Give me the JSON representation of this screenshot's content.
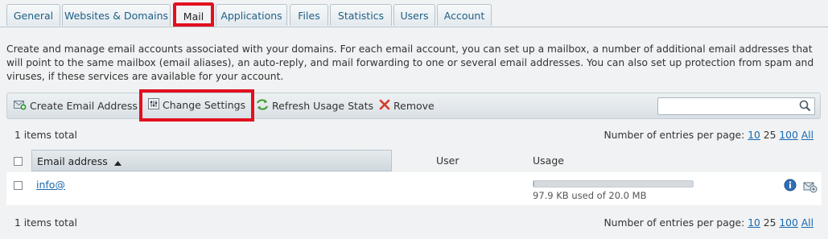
{
  "tabs": [
    "General",
    "Websites & Domains",
    "Mail",
    "Applications",
    "Files",
    "Statistics",
    "Users",
    "Account"
  ],
  "description": "Create and manage email accounts associated with your domains. For each email account, you can set up a mailbox, a number of additional email addresses that will point to the same mailbox (email aliases), an auto-reply, and mail forwarding to one or several email addresses. You can also set up protection from spam and viruses, if these services are available for your account.",
  "toolbar": {
    "create": "Create Email Address",
    "change": "Change Settings",
    "refresh": "Refresh Usage Stats",
    "remove": "Remove",
    "search_value": ""
  },
  "list": {
    "total": "1 items total",
    "per_page_label": "Number of entries per page:",
    "per_page_options": [
      "10",
      "25",
      "100",
      "All"
    ]
  },
  "columns": {
    "email": "Email address",
    "user": "User",
    "usage": "Usage"
  },
  "rows": [
    {
      "email": "info@",
      "user": "",
      "usage_text": "97.9 KB used of 20.0 MB",
      "usage_fraction": 0.005
    }
  ],
  "colors": {
    "highlight": "#e3101e",
    "link": "#1769b0"
  }
}
